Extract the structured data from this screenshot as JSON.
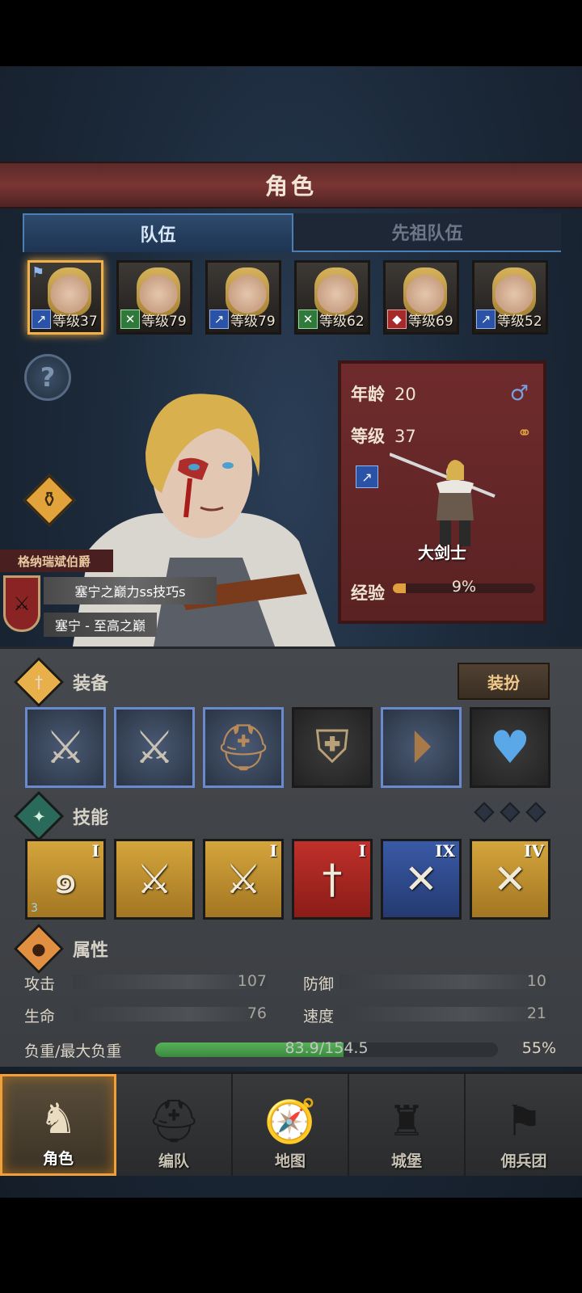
{
  "header": {
    "title": "角色"
  },
  "tabs": [
    {
      "label": "队伍",
      "active": true
    },
    {
      "label": "先祖队伍",
      "active": false
    }
  ],
  "roster": [
    {
      "level": "等级37",
      "class_icon": "sword-icon",
      "selected": true,
      "flag": true
    },
    {
      "level": "等级79",
      "class_icon": "crossed-x-icon",
      "selected": false
    },
    {
      "level": "等级79",
      "class_icon": "sword-icon",
      "selected": false
    },
    {
      "level": "等级62",
      "class_icon": "crossed-x-icon",
      "selected": false
    },
    {
      "level": "等级69",
      "class_icon": "wolf-icon",
      "selected": false
    },
    {
      "level": "等级52",
      "class_icon": "sword-icon",
      "selected": false
    }
  ],
  "character": {
    "age_label": "年龄",
    "age": "20",
    "level_label": "等级",
    "level": "37",
    "gender_icon": "male-icon",
    "class_name": "大剑士",
    "exp_label": "经验",
    "exp_percent_text": "9%",
    "exp_fraction": 0.09
  },
  "titles": {
    "noble": "格纳瑞斌伯爵",
    "title1": "塞宁之巅力ss技巧s",
    "title2": "塞宁 - 至高之巅"
  },
  "equipment": {
    "label": "装备",
    "dress_button": "装扮",
    "slots": [
      {
        "name": "spear-icon",
        "glyph": "⚔"
      },
      {
        "name": "spear-icon",
        "glyph": "⚔"
      },
      {
        "name": "helmet-icon",
        "glyph": "⛑"
      },
      {
        "name": "armor-icon",
        "glyph": "🛡"
      },
      {
        "name": "boots-icon",
        "glyph": "👢"
      },
      {
        "name": "amulet-icon",
        "glyph": "♥"
      }
    ]
  },
  "skills": {
    "label": "技能",
    "items": [
      {
        "name": "whirlwind-icon",
        "rank": "I",
        "stack": "3",
        "glyph": "🌀"
      },
      {
        "name": "sword-aura-icon",
        "rank": "",
        "glyph": "⚔"
      },
      {
        "name": "sword-aura-icon",
        "rank": "I",
        "glyph": "⚔"
      },
      {
        "name": "sword-icon",
        "rank": "I",
        "glyph": "🗡"
      },
      {
        "name": "crossed-swords-icon",
        "rank": "IX",
        "glyph": "✕"
      },
      {
        "name": "crossed-swords-icon",
        "rank": "IV",
        "glyph": "✕"
      }
    ]
  },
  "attributes": {
    "label": "属性",
    "attack_label": "攻击",
    "attack": "107",
    "defense_label": "防御",
    "defense": "10",
    "hp_label": "生命",
    "hp": "76",
    "speed_label": "速度",
    "speed": "21",
    "load_label": "负重/最大负重",
    "load_text": "83.9/154.5",
    "load_percent": "55%",
    "load_fraction": 0.55
  },
  "nav": [
    {
      "label": "角色",
      "active": true
    },
    {
      "label": "编队",
      "active": false
    },
    {
      "label": "地图",
      "active": false
    },
    {
      "label": "城堡",
      "active": false
    },
    {
      "label": "佣兵团",
      "active": false
    }
  ]
}
